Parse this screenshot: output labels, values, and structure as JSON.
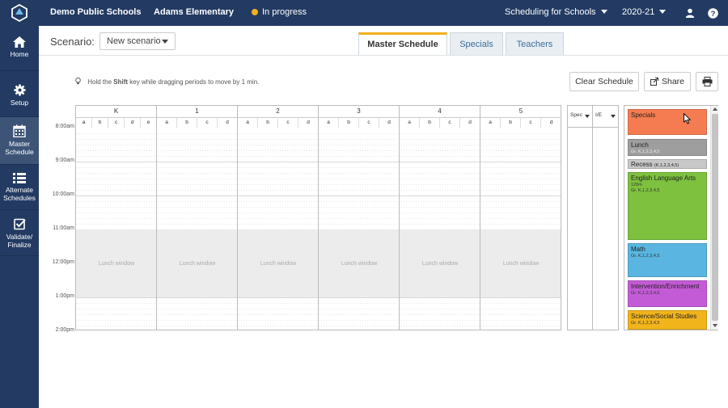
{
  "topbar": {
    "district": "Demo Public Schools",
    "school": "Adams Elementary",
    "status": "In progress",
    "product": "Scheduling for Schools",
    "year": "2020-21",
    "status_color": "#f2b01e",
    "bar_color": "#233b63"
  },
  "sidebar": {
    "items": [
      {
        "label": "Home",
        "icon": "home-icon"
      },
      {
        "label": "Setup",
        "icon": "gear-icon"
      },
      {
        "label": "Master Schedule",
        "icon": "calendar-icon"
      },
      {
        "label": "Alternate Schedules",
        "icon": "list-icon"
      },
      {
        "label": "Validate/ Finalize",
        "icon": "checkbox-icon"
      }
    ]
  },
  "scenario": {
    "label": "Scenario:",
    "value": "New scenario"
  },
  "tabs": [
    {
      "label": "Master Schedule",
      "active": true
    },
    {
      "label": "Specials",
      "active": false
    },
    {
      "label": "Teachers",
      "active": false
    }
  ],
  "hint": {
    "prefix": "Hold the",
    "key": "Shift",
    "suffix": "key while dragging periods to move by 1 min."
  },
  "buttons": {
    "clear": "Clear Schedule",
    "share": "Share"
  },
  "grid": {
    "grades": [
      {
        "name": "K",
        "sections": [
          "a",
          "b",
          "c",
          "d",
          "e"
        ]
      },
      {
        "name": "1",
        "sections": [
          "a",
          "b",
          "c",
          "d"
        ]
      },
      {
        "name": "2",
        "sections": [
          "a",
          "b",
          "c",
          "d"
        ]
      },
      {
        "name": "3",
        "sections": [
          "a",
          "b",
          "c",
          "d"
        ]
      },
      {
        "name": "4",
        "sections": [
          "a",
          "b",
          "c",
          "d"
        ]
      },
      {
        "name": "5",
        "sections": [
          "a",
          "b",
          "c",
          "d"
        ]
      }
    ],
    "times": [
      "8:00am",
      "9:00am",
      "10:00am",
      "11:00am",
      "12:00pm",
      "1:00pm",
      "2:00pm"
    ],
    "lunch_label": "Lunch window",
    "extra_columns": [
      "Spec",
      "I/E"
    ]
  },
  "periods": [
    {
      "name": "Specials",
      "sub": "",
      "color": "#f47c50"
    },
    {
      "name": "Lunch",
      "sub": "Gr. K,1,2,3,4,5",
      "color": "#9e9e9e"
    },
    {
      "name": "Recess",
      "sub": "(K,1,2,3,4,5)",
      "color": "#c8c8c8"
    },
    {
      "name": "English Language Arts",
      "sub": "120m",
      "sub2": "Gr. K,1,2,3,4,5",
      "color": "#7dc13f"
    },
    {
      "name": "Math",
      "sub": "Gr. K,1,2,3,4,5",
      "color": "#5ab6e1"
    },
    {
      "name": "Intervention/Enrichment",
      "sub": "Gr. K,1,2,3,4,5",
      "color": "#c45bd6"
    },
    {
      "name": "Science/Social Studies",
      "sub": "Gr. K,1,2,3,4,5",
      "color": "#f1b41a"
    }
  ]
}
